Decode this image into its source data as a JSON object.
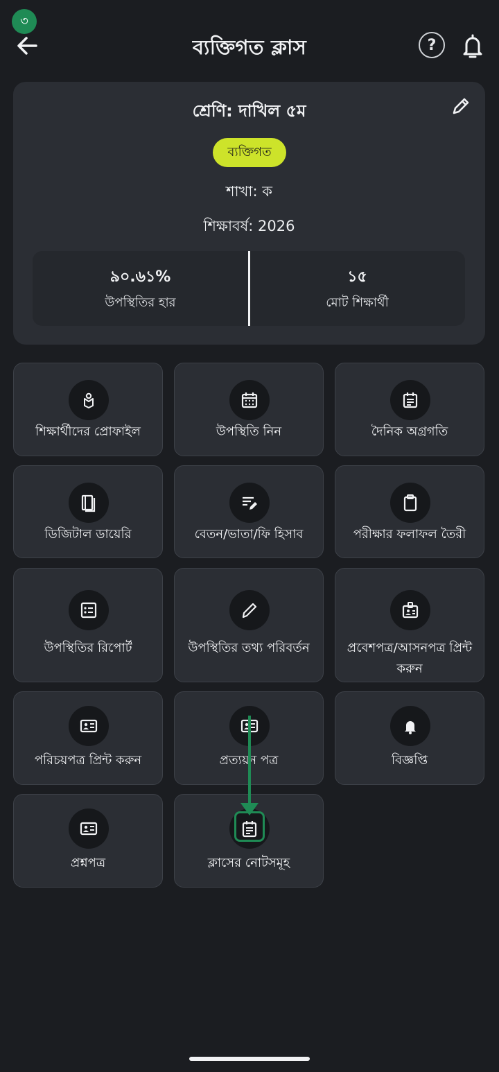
{
  "step_badge": "৩",
  "header": {
    "title": "ব্যক্তিগত ক্লাস",
    "help_label": "?"
  },
  "class_info": {
    "class_name": "শ্রেণি: দাখিল ৫ম",
    "type_pill": "ব্যক্তিগত",
    "section": "শাখা: ক",
    "year": "শিক্ষাবর্ষ: 2026",
    "attendance_rate": {
      "value": "৯০.৬১%",
      "label": "উপস্থিতির হার"
    },
    "total_students": {
      "value": "১৫",
      "label": "মোট শিক্ষার্থী"
    }
  },
  "tiles": [
    {
      "label": "শিক্ষার্থীদের প্রোফাইল",
      "icon": "student-profile-icon"
    },
    {
      "label": "উপস্থিতি নিন",
      "icon": "calendar-icon"
    },
    {
      "label": "দৈনিক অগ্রগতি",
      "icon": "daily-progress-icon"
    },
    {
      "label": "ডিজিটাল ডায়েরি",
      "icon": "book-icon"
    },
    {
      "label": "বেতন/ভাতা/ফি হিসাব",
      "icon": "fee-edit-icon"
    },
    {
      "label": "পরীক্ষার ফলাফল তৈরী",
      "icon": "clipboard-icon"
    },
    {
      "label": "উপস্থিতির রিপোর্ট",
      "icon": "report-list-icon"
    },
    {
      "label": "উপস্থিতির তথ্য পরিবর্তন",
      "icon": "pencil-icon"
    },
    {
      "label": "প্রবেশপত্র/আসনপত্র প্রিন্ট করুন",
      "icon": "admit-card-icon"
    },
    {
      "label": "পরিচয়পত্র প্রিন্ট করুন",
      "icon": "id-card-icon"
    },
    {
      "label": "প্রত্যয়ন পত্র",
      "icon": "certificate-icon"
    },
    {
      "label": "বিজ্ঞপ্তি",
      "icon": "bell-icon"
    },
    {
      "label": "প্রশ্নপত্র",
      "icon": "question-paper-icon"
    },
    {
      "label": "ক্লাসের নোটসমূহ",
      "icon": "class-notes-icon"
    }
  ]
}
